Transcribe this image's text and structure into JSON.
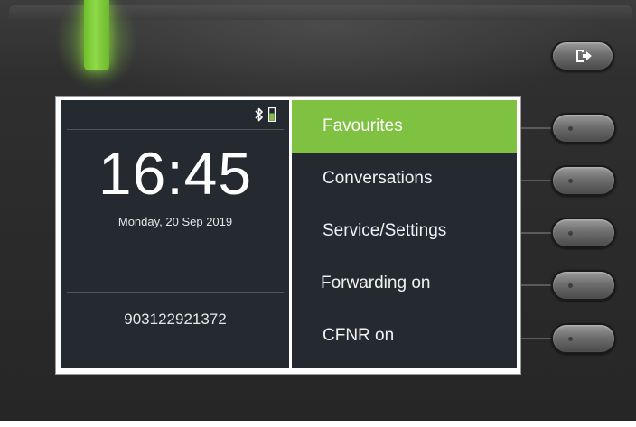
{
  "status": {
    "bluetooth_icon": "bluetooth-icon",
    "battery_icon": "battery-icon"
  },
  "clock": {
    "time": "16:45",
    "date": "Monday, 20 Sep 2019"
  },
  "phone_number": "903122921372",
  "menu": {
    "items": [
      {
        "label": "Favourites"
      },
      {
        "label": "Conversations"
      },
      {
        "label": "Service/Settings"
      },
      {
        "label": "Forwarding on"
      },
      {
        "label": "CFNR on"
      }
    ],
    "selected_index": 0
  },
  "hardware": {
    "logout_icon": "logout-icon",
    "led_color": "#7fc241"
  },
  "colors": {
    "screen_background": "#242a30",
    "accent": "#7fc241"
  }
}
